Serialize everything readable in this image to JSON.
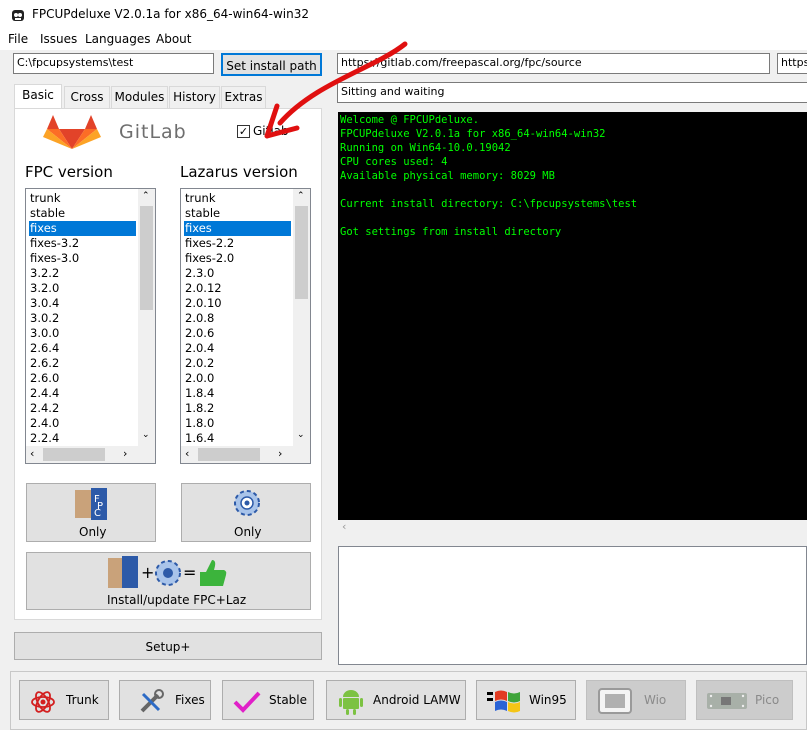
{
  "window": {
    "title": "FPCUPdeluxe V2.0.1a for x86_64-win64-win32"
  },
  "menu": [
    "File",
    "Issues",
    "Languages",
    "About"
  ],
  "install_path": {
    "value": "C:\\fpcupsystems\\test",
    "button": "Set install path"
  },
  "fpc_url": "https://gitlab.com/freepascal.org/fpc/source",
  "laz_url_fragment": "https",
  "status": "Sitting and waiting",
  "tabs": [
    "Basic",
    "Cross",
    "Modules",
    "History",
    "Extras"
  ],
  "gitlab": {
    "logo_text": "GitLab",
    "checkbox_label": "Gitlab",
    "checked": true
  },
  "fpc": {
    "heading": "FPC version",
    "items": [
      "trunk",
      "stable",
      "fixes",
      "fixes-3.2",
      "fixes-3.0",
      "3.2.2",
      "3.2.0",
      "3.0.4",
      "3.0.2",
      "3.0.0",
      "2.6.4",
      "2.6.2",
      "2.6.0",
      "2.4.4",
      "2.4.2",
      "2.4.0",
      "2.2.4"
    ],
    "selected": "fixes",
    "only_label": "Only"
  },
  "lazarus": {
    "heading": "Lazarus version",
    "items": [
      "trunk",
      "stable",
      "fixes",
      "fixes-2.2",
      "fixes-2.0",
      "2.3.0",
      "2.0.12",
      "2.0.10",
      "2.0.8",
      "2.0.6",
      "2.0.4",
      "2.0.2",
      "2.0.0",
      "1.8.4",
      "1.8.2",
      "1.8.0",
      "1.6.4"
    ],
    "selected": "fixes",
    "only_label": "Only"
  },
  "install_button": "Install/update FPC+Laz",
  "setup_button": "Setup+",
  "console_lines": [
    "Welcome @ FPCUPdeluxe.",
    "FPCUPdeluxe V2.0.1a for x86_64-win64-win32",
    "Running on Win64-10.0.19042",
    "CPU cores used: 4",
    "Available physical memory: 8029 MB",
    "",
    "Current install directory: C:\\fpcupsystems\\test",
    "",
    "Got settings from install directory"
  ],
  "bottom_buttons": [
    {
      "label": "Trunk",
      "icon": "atom-icon",
      "enabled": true
    },
    {
      "label": "Fixes",
      "icon": "tools-icon",
      "enabled": true
    },
    {
      "label": "Stable",
      "icon": "checkmark-icon",
      "enabled": true
    },
    {
      "label": "Android LAMW",
      "icon": "android-icon",
      "enabled": true
    },
    {
      "label": "Win95",
      "icon": "windows-flag-icon",
      "enabled": true
    },
    {
      "label": "Wio",
      "icon": "wio-terminal-icon",
      "enabled": false
    },
    {
      "label": "Pico",
      "icon": "pico-board-icon",
      "enabled": false
    }
  ],
  "colors": {
    "selection": "#0078d7",
    "console_bg": "#000000",
    "console_text": "#00ff00",
    "annotation_arrow": "#e01010",
    "gitlab_orange": "#e24329"
  }
}
